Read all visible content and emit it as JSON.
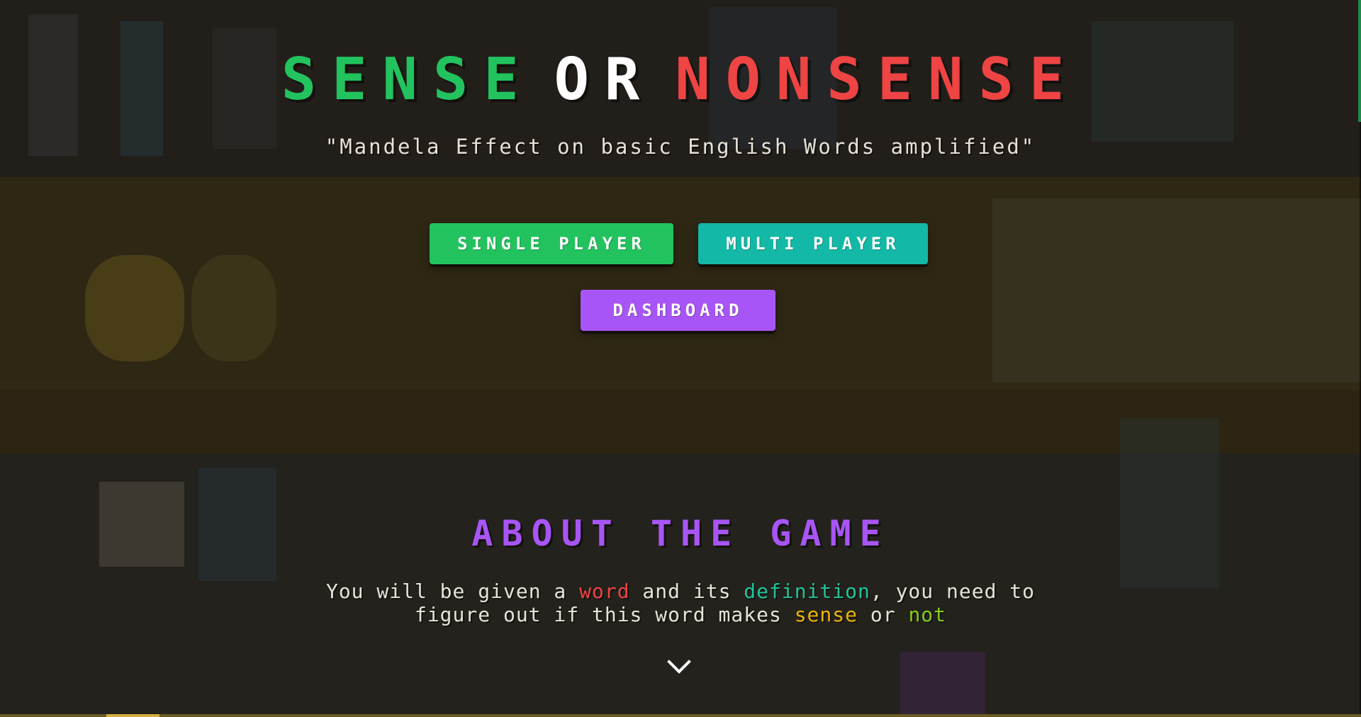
{
  "title": {
    "word1": "SENSE",
    "word2": "OR",
    "word3": "NONSENSE"
  },
  "subtitle": "\"Mandela Effect on basic English Words amplified\"",
  "buttons": {
    "single_player": "SINGLE PLAYER",
    "multi_player": "MULTI PLAYER",
    "dashboard": "DASHBOARD"
  },
  "about": {
    "heading": "ABOUT THE GAME",
    "text_part1": "You will be given a ",
    "word": "word",
    "text_part2": " and its ",
    "definition": "definition",
    "text_part3": ", you need to figure out if this word makes ",
    "sense": "sense",
    "text_part4": " or ",
    "not": "not"
  },
  "icons": {
    "scroll_down": "chevron-down-icon"
  },
  "colors": {
    "sense": "#22c35e",
    "or": "#ffffff",
    "nonsense": "#ef4444",
    "single_player_bg": "#22c35e",
    "multi_player_bg": "#14b8a6",
    "dashboard_bg": "#a855f7",
    "about_heading": "#a855f7"
  }
}
